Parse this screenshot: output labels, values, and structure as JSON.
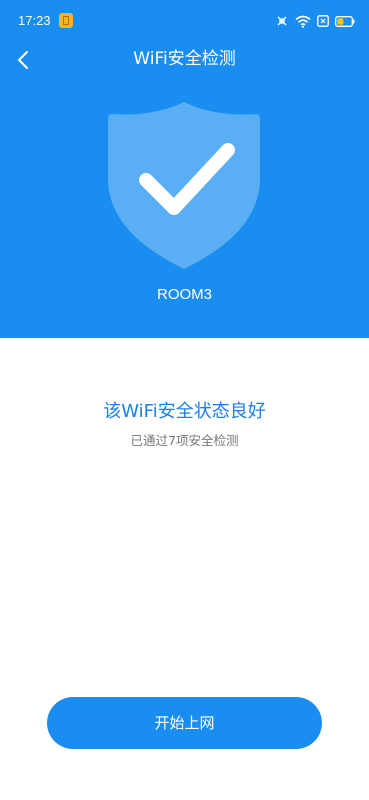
{
  "status_bar": {
    "time": "17:23",
    "battery_level": 0.4,
    "icons": [
      "app-notification-icon",
      "hd-icon",
      "wifi-icon",
      "signal-icon",
      "battery-icon"
    ]
  },
  "header": {
    "title": "WiFi安全检测",
    "back_icon": "chevron-left-icon"
  },
  "shield": {
    "icon": "shield-check-icon",
    "network_name": "ROOM3"
  },
  "result": {
    "title": "该WiFi安全状态良好",
    "subtitle": "已通过7项安全检测"
  },
  "actions": {
    "primary_label": "开始上网"
  },
  "colors": {
    "primary": "#1a8df0",
    "shield_fill": "#5aaef3",
    "status_text": "#1a7fe6",
    "subtitle_text": "#777777"
  }
}
